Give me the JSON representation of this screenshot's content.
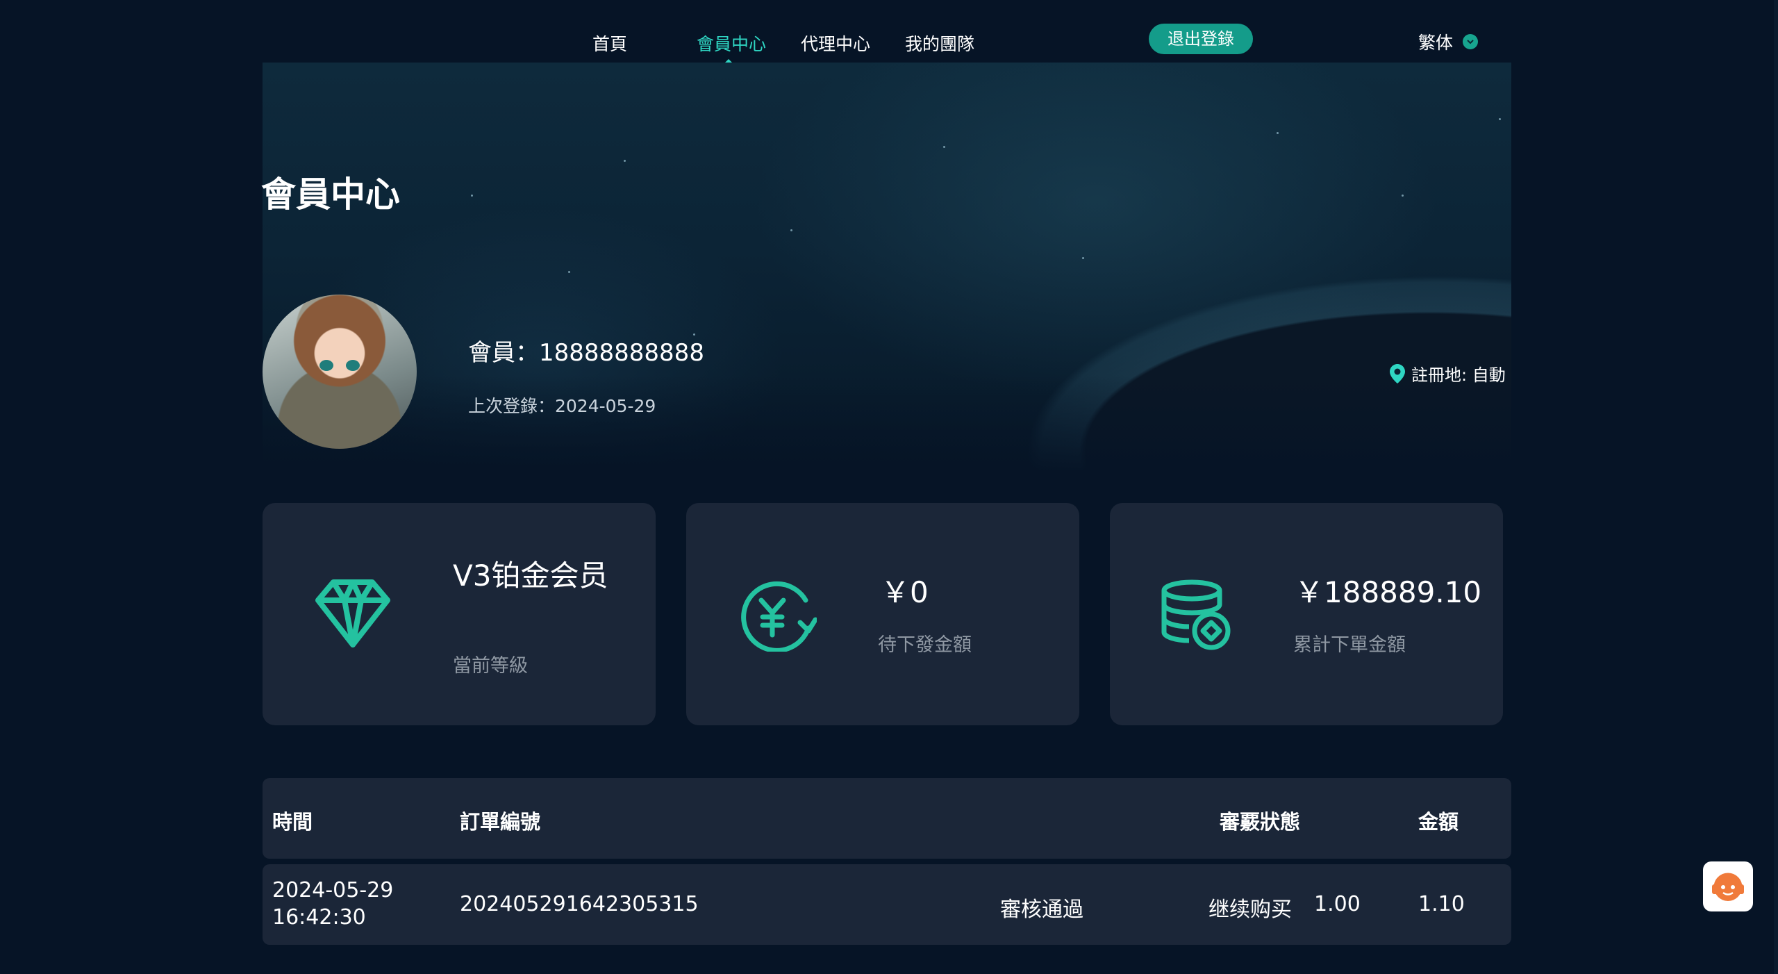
{
  "nav": {
    "items": [
      {
        "label": "首頁",
        "active": false
      },
      {
        "label": "會員中心",
        "active": true
      },
      {
        "label": "代理中心",
        "active": false
      },
      {
        "label": "我的團隊",
        "active": false
      }
    ],
    "logout_label": "退出登錄",
    "language": "繁体"
  },
  "hero": {
    "title": "會員中心",
    "member": "會員：18888888888",
    "last_login": "上次登錄：2024-05-29",
    "register_place": "註冊地:  自動"
  },
  "cards": [
    {
      "icon": "diamond-icon",
      "value": "V3铂金会员",
      "label": "當前等級"
    },
    {
      "icon": "yen-refund-icon",
      "value": "￥0",
      "label": "待下發金額"
    },
    {
      "icon": "coin-stack-icon",
      "value": "￥188889.10",
      "label": "累計下單金額"
    }
  ],
  "table": {
    "headers": [
      "時間",
      "訂單編號",
      "審覈狀態",
      "金額"
    ],
    "rows": [
      {
        "time_date": "2024-05-29",
        "time_clock": "16:42:30",
        "order_no": "202405291642305315",
        "status": "審核通過",
        "action": "继续购买",
        "amount_a": "1.00",
        "amount_b": "1.10"
      }
    ]
  },
  "colors": {
    "accent": "#2fd6c3",
    "button": "#149c8a",
    "background": "#061426",
    "card": "#1b2638",
    "muted_text": "#8f98a3"
  }
}
